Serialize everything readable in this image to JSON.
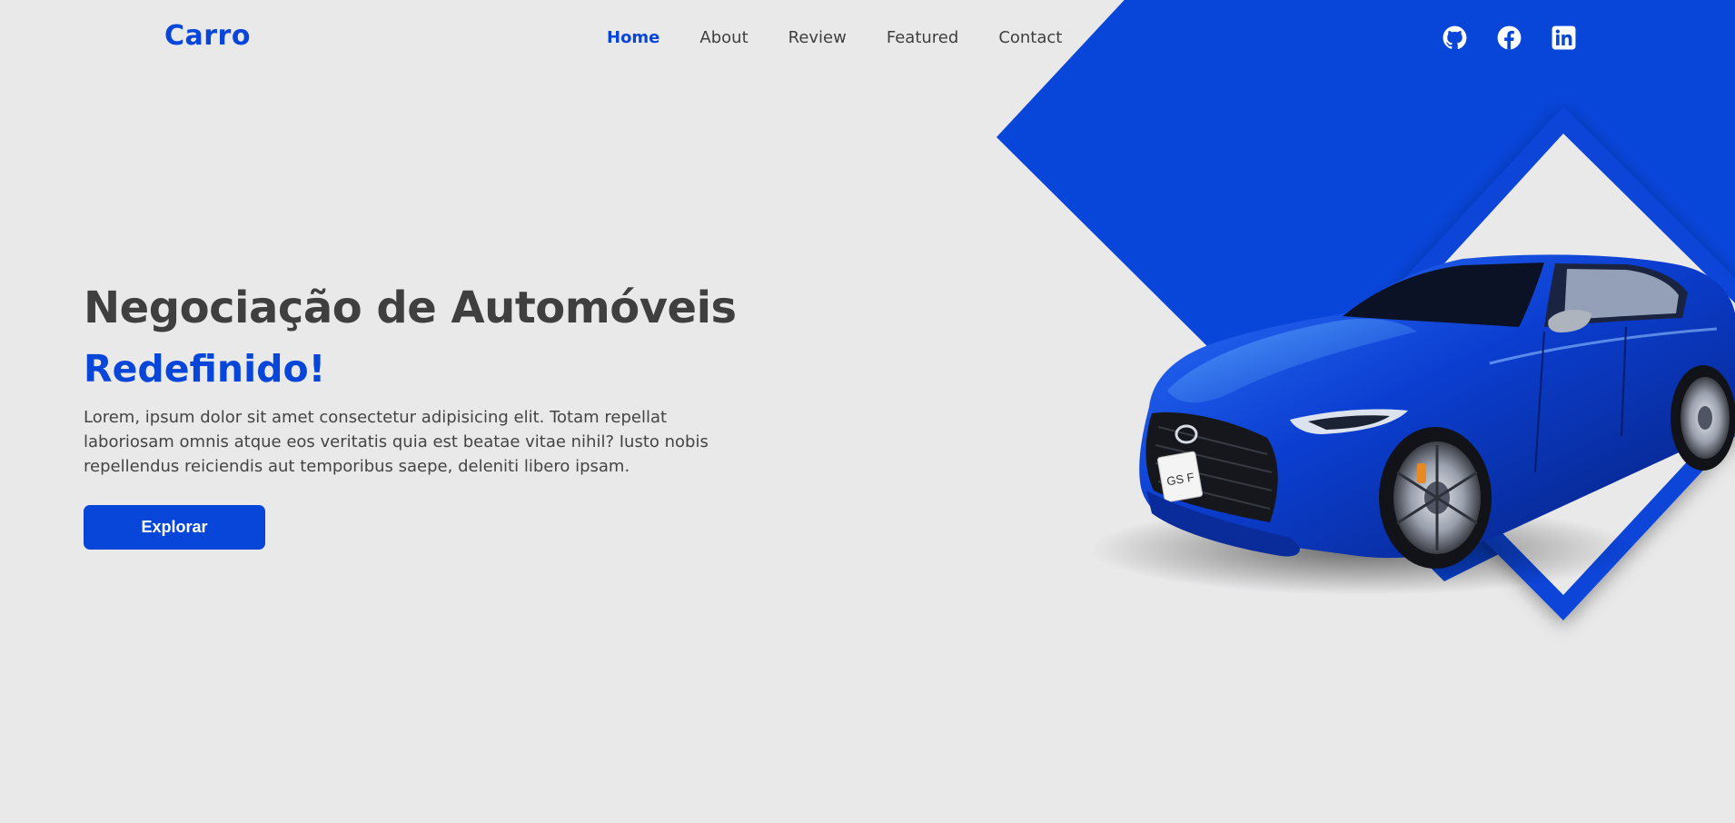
{
  "brand": {
    "name": "Carro",
    "accent_color": "#0845d9",
    "background_color": "#e9e9ea"
  },
  "nav": {
    "items": [
      {
        "label": "Home",
        "active": true
      },
      {
        "label": "About",
        "active": false
      },
      {
        "label": "Review",
        "active": false
      },
      {
        "label": "Featured",
        "active": false
      },
      {
        "label": "Contact",
        "active": false
      }
    ]
  },
  "socials": [
    {
      "icon": "github-icon"
    },
    {
      "icon": "facebook-icon"
    },
    {
      "icon": "linkedin-icon"
    }
  ],
  "hero": {
    "title": "Negociação de Automóveis",
    "subtitle": "Redefinido!",
    "description": "Lorem, ipsum dolor sit amet consectetur adipisicing elit. Totam repellat laboriosam omnis atque eos veritatis quia est beatae vitae nihil? Iusto nobis repellendus reiciendis aut temporibus saepe, deleniti libero ipsam.",
    "button_label": "Explorar"
  },
  "car_image": {
    "plate_text": "GS F"
  }
}
